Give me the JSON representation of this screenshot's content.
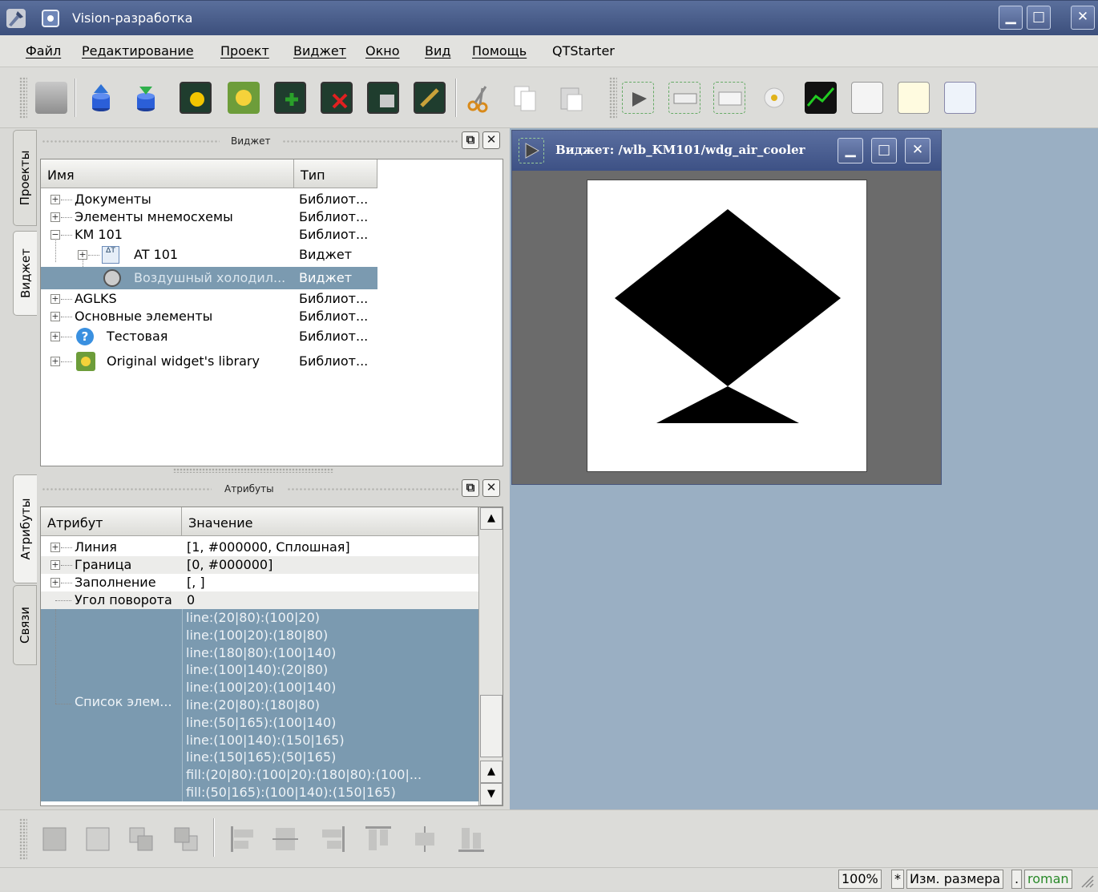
{
  "window": {
    "title": "Vision-разработка"
  },
  "menu": [
    "Файл",
    "Редактирование",
    "Проект",
    "Виджет",
    "Окно",
    "Вид",
    "Помощь",
    "QTStarter"
  ],
  "toolbar_icons": [
    "db-save-icon",
    "upload-icon",
    "download-icon",
    "new-library-icon",
    "new-widget-icon",
    "add-widget-icon",
    "delete-widget-icon",
    "widget-properties-icon",
    "widget-edit-icon",
    "cut-icon",
    "copy-icon",
    "paste-icon",
    "elfigure-icon",
    "form-element-icon",
    "text-icon",
    "media-icon",
    "diagram-icon",
    "protocol-icon",
    "document-icon",
    "value-icon"
  ],
  "left_tabs": {
    "projects": "Проекты",
    "widget": "Виджет",
    "attributes": "Атрибуты",
    "links": "Связи"
  },
  "widget_panel": {
    "title": "Виджет",
    "columns": [
      "Имя",
      "Тип"
    ],
    "rows": [
      {
        "name": "Документы",
        "type": "Библиот..."
      },
      {
        "name": "Элементы мнемосхемы",
        "type": "Библиот..."
      },
      {
        "name": "KM 101",
        "type": "Библиот..."
      },
      {
        "name": "AT 101",
        "type": "Виджет"
      },
      {
        "name": "Воздушный холодил...",
        "type": "Виджет"
      },
      {
        "name": "AGLKS",
        "type": "Библиот..."
      },
      {
        "name": "Основные элементы",
        "type": "Библиот..."
      },
      {
        "name": "Тестовая",
        "type": "Библиот..."
      },
      {
        "name": "Original widget's library",
        "type": "Библиот..."
      }
    ]
  },
  "attr_panel": {
    "title": "Атрибуты",
    "columns": [
      "Атрибут",
      "Значение"
    ],
    "rows": [
      {
        "name": "Линия",
        "value": "[1, #000000, Сплошная]"
      },
      {
        "name": "Граница",
        "value": "[0, #000000]"
      },
      {
        "name": "Заполнение",
        "value": "[, ]"
      },
      {
        "name": "Угол поворота",
        "value": "0"
      }
    ],
    "elements_list": {
      "name": "Список элем...",
      "lines": [
        "line:(20|80):(100|20)",
        "line:(100|20):(180|80)",
        "line:(180|80):(100|140)",
        "line:(100|140):(20|80)",
        "line:(100|20):(100|140)",
        "line:(20|80):(180|80)",
        "line:(50|165):(100|140)",
        "line:(100|140):(150|165)",
        "line:(150|165):(50|165)",
        "fill:(20|80):(100|20):(180|80):(100|...",
        "fill:(50|165):(100|140):(150|165)"
      ]
    }
  },
  "subwindow": {
    "title": "Виджет: /wlb_KM101/wdg_air_cooler"
  },
  "bottom_icons": [
    "level-rise-icon",
    "level-lower-icon",
    "level-up-icon",
    "level-down-icon",
    "align-left-icon",
    "align-vcenter-icon",
    "align-right-icon",
    "align-top-icon",
    "align-hcenter-icon",
    "align-bottom-icon"
  ],
  "status": {
    "zoom": "100%",
    "modified": "*",
    "mode": "Изм. размера",
    "sep": ".",
    "user": "roman"
  },
  "colors": {
    "selection": "#7b9ab0",
    "mdi_background": "#9aafc3",
    "title_bar": "#4a5e90",
    "user_text": "#2a8a2a"
  }
}
